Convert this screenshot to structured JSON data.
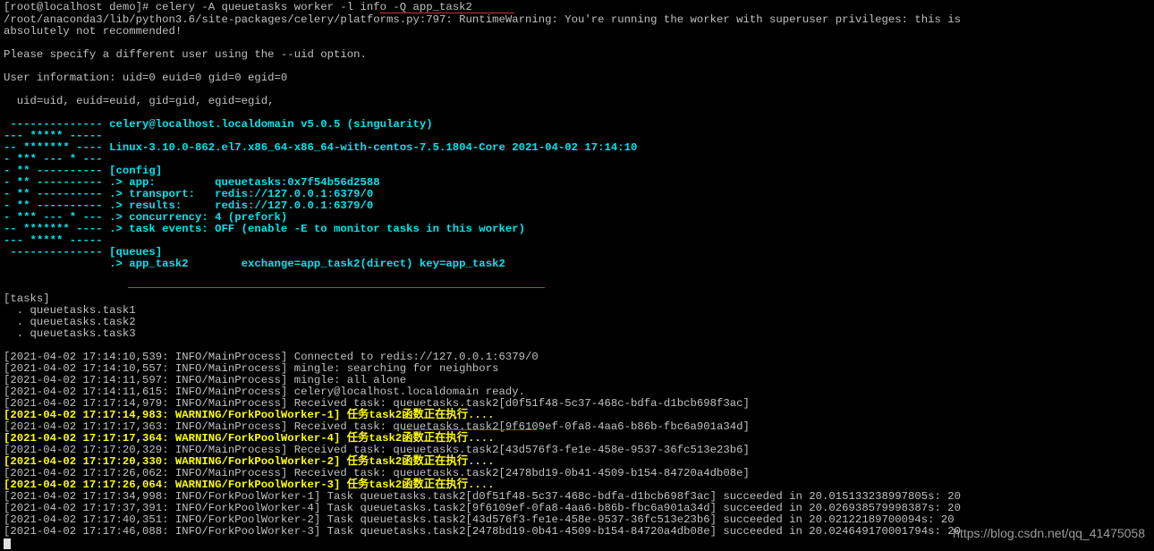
{
  "terminal": {
    "lines": [
      "[root@localhost demo]# celery -A queuetasks worker -l info -Q app_task2",
      "/root/anaconda3/lib/python3.6/site-packages/celery/platforms.py:797: RuntimeWarning: You're running the worker with superuser privileges: this is",
      "absolutely not recommended!",
      "Please specify a different user using the --uid option.",
      "User information: uid=0 euid=0 gid=0 egid=0",
      "  uid=uid, euid=euid, gid=gid, egid=egid,",
      " -------------- celery@localhost.localdomain v5.0.5 (singularity)",
      "--- ***** -----",
      "-- ******* ---- Linux-3.10.0-862.el7.x86_64-x86_64-with-centos-7.5.1804-Core 2021-04-02 17:14:10",
      "- *** --- * ---",
      "- ** ---------- [config]",
      "- ** ---------- .> app:         queuetasks:0x7f54b56d2588",
      "- ** ---------- .> transport:   redis://127.0.0.1:6379/0",
      "- ** ---------- .> results:     redis://127.0.0.1:6379/0",
      "- *** --- * --- .> concurrency: 4 (prefork)",
      "-- ******* ---- .> task events: OFF (enable -E to monitor tasks in this worker)",
      "--- ***** -----",
      " -------------- [queues]",
      "                .> app_task2        exchange=app_task2(direct) key=app_task2",
      "[tasks]",
      "  . queuetasks.task1",
      "  . queuetasks.task2",
      "  . queuetasks.task3",
      "[2021-04-02 17:14:10,539: INFO/MainProcess] Connected to redis://127.0.0.1:6379/0",
      "[2021-04-02 17:14:10,557: INFO/MainProcess] mingle: searching for neighbors",
      "[2021-04-02 17:14:11,597: INFO/MainProcess] mingle: all alone",
      "[2021-04-02 17:14:11,615: INFO/MainProcess] celery@localhost.localdomain ready.",
      "[2021-04-02 17:17:14,979: INFO/MainProcess] Received task: queuetasks.task2[d0f51f48-5c37-468c-bdfa-d1bcb698f3ac]",
      "[2021-04-02 17:17:14,983: WARNING/ForkPoolWorker-1] 任务task2函数正在执行....",
      "[2021-04-02 17:17:17,363: INFO/MainProcess] Received task: queuetasks.task2[9f6109ef-0fa8-4aa6-b86b-fbc6a901a34d]",
      "[2021-04-02 17:17:17,364: WARNING/ForkPoolWorker-4] 任务task2函数正在执行....",
      "[2021-04-02 17:17:20,329: INFO/MainProcess] Received task: queuetasks.task2[43d576f3-fe1e-458e-9537-36fc513e23b6]",
      "[2021-04-02 17:17:20,330: WARNING/ForkPoolWorker-2] 任务task2函数正在执行....",
      "[2021-04-02 17:17:26,062: INFO/MainProcess] Received task: queuetasks.task2[2478bd19-0b41-4509-b154-84720a4db08e]",
      "[2021-04-02 17:17:26,064: WARNING/ForkPoolWorker-3] 任务task2函数正在执行....",
      "[2021-04-02 17:17:34,998: INFO/ForkPoolWorker-1] Task queuetasks.task2[d0f51f48-5c37-468c-bdfa-d1bcb698f3ac] succeeded in 20.015133238997805s: 20",
      "[2021-04-02 17:17:37,391: INFO/ForkPoolWorker-4] Task queuetasks.task2[9f6109ef-0fa8-4aa6-b86b-fbc6a901a34d] succeeded in 20.026938579998387s: 20",
      "[2021-04-02 17:17:40,351: INFO/ForkPoolWorker-2] Task queuetasks.task2[43d576f3-fe1e-458e-9537-36fc513e23b6] succeeded in 20.02122189700094s: 20",
      "[2021-04-02 17:17:46,088: INFO/ForkPoolWorker-3] Task queuetasks.task2[2478bd19-0b41-4509-b154-84720a4db08e] succeeded in 20.024649170001794s: 20"
    ]
  },
  "watermark": "https://blog.csdn.net/qq_41475058",
  "colors": {
    "background": "#000000",
    "text": "#c0c0c0",
    "banner": "#00e5ee",
    "warning": "#ffff00",
    "annotation": "#d03030"
  }
}
